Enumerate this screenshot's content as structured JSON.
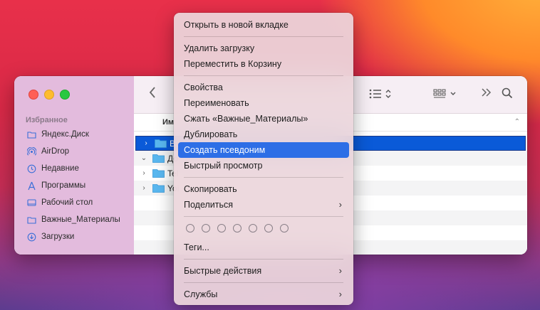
{
  "sidebar": {
    "section": "Избранное",
    "items": [
      {
        "label": "Яндекс.Диск",
        "icon": "folder-icon"
      },
      {
        "label": "AirDrop",
        "icon": "airdrop-icon"
      },
      {
        "label": "Недавние",
        "icon": "clock-icon"
      },
      {
        "label": "Программы",
        "icon": "apps-icon"
      },
      {
        "label": "Рабочий стол",
        "icon": "desktop-icon"
      },
      {
        "label": "Важные_Материалы",
        "icon": "folder-icon"
      },
      {
        "label": "Загрузки",
        "icon": "download-icon"
      }
    ]
  },
  "header": {
    "name_column": "Им"
  },
  "files": [
    {
      "name": "Ва",
      "selected": true,
      "chevron": "›"
    },
    {
      "name": "До",
      "selected": false,
      "chevron": "⌄"
    },
    {
      "name": "Tel",
      "selected": false,
      "chevron": "›"
    },
    {
      "name": "Yoi",
      "selected": false,
      "chevron": "›"
    }
  ],
  "context_menu": {
    "open_new_tab": "Открыть в новой вкладке",
    "delete_download": "Удалить загрузку",
    "move_to_trash": "Переместить в Корзину",
    "properties": "Свойства",
    "rename": "Переименовать",
    "compress": "Сжать «Важные_Материалы»",
    "duplicate": "Дублировать",
    "make_alias": "Создать псевдоним",
    "quick_look": "Быстрый просмотр",
    "copy": "Скопировать",
    "share": "Поделиться",
    "tags": "Теги...",
    "quick_actions": "Быстрые действия",
    "services": "Службы"
  },
  "colors": {
    "highlight": "#2d6ee6",
    "selection": "#0a5ad8",
    "folder": "#5ab8f0"
  }
}
